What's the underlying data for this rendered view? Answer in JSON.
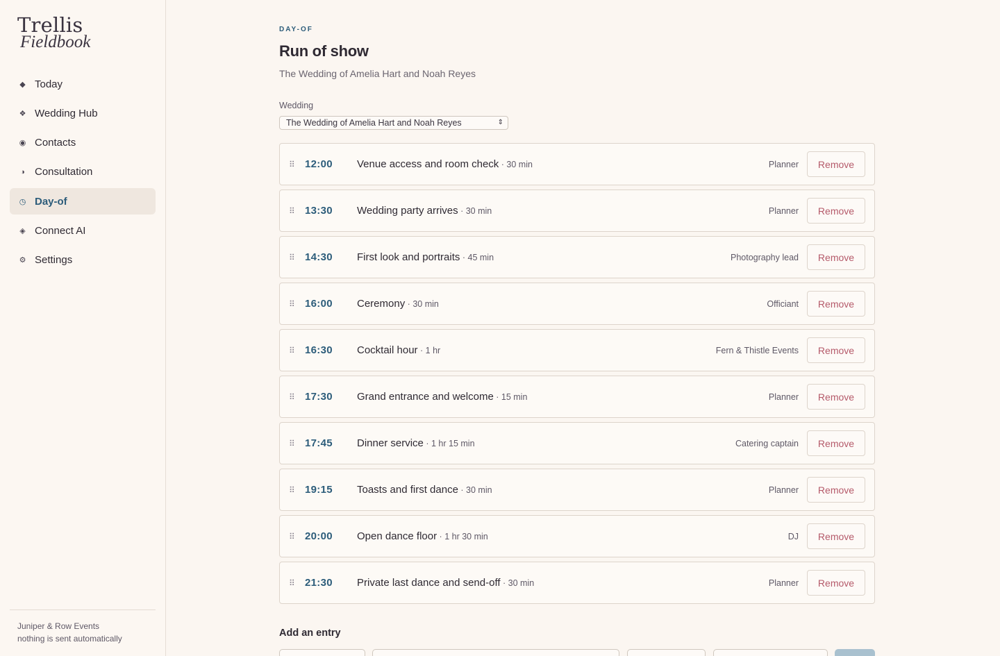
{
  "brand": {
    "line1": "Trellis",
    "line2": "Fieldbook"
  },
  "nav": [
    {
      "label": "Today",
      "icon": "diamond-icon",
      "glyph": "◆",
      "active": false
    },
    {
      "label": "Wedding Hub",
      "icon": "four-diamonds-icon",
      "glyph": "❖",
      "active": false
    },
    {
      "label": "Contacts",
      "icon": "circle-dot-icon",
      "glyph": "◉",
      "active": false
    },
    {
      "label": "Consultation",
      "icon": "half-circle-icon",
      "glyph": "◑",
      "active": false
    },
    {
      "label": "Day-of",
      "icon": "clock-icon",
      "glyph": "◷",
      "active": true
    },
    {
      "label": "Connect AI",
      "icon": "diamond-outline-icon",
      "glyph": "◈",
      "active": false
    },
    {
      "label": "Settings",
      "icon": "gear-icon",
      "glyph": "⚙",
      "active": false
    }
  ],
  "sidebar_footer": {
    "org": "Juniper & Row Events",
    "note": "nothing is sent automatically"
  },
  "header": {
    "eyebrow": "DAY-OF",
    "title": "Run of show",
    "subtitle": "The Wedding of Amelia Hart and Noah Reyes"
  },
  "wedding_select": {
    "label": "Wedding",
    "value": "The Wedding of Amelia Hart and Noah Reyes"
  },
  "entries": [
    {
      "time": "12:00",
      "task": "Venue access and room check",
      "duration": "30 min",
      "owner": "Planner",
      "action": "Remove"
    },
    {
      "time": "13:30",
      "task": "Wedding party arrives",
      "duration": "30 min",
      "owner": "Planner",
      "action": "Remove"
    },
    {
      "time": "14:30",
      "task": "First look and portraits",
      "duration": "45 min",
      "owner": "Photography lead",
      "action": "Remove"
    },
    {
      "time": "16:00",
      "task": "Ceremony",
      "duration": "30 min",
      "owner": "Officiant",
      "action": "Remove"
    },
    {
      "time": "16:30",
      "task": "Cocktail hour",
      "duration": "1 hr",
      "owner": "Fern & Thistle Events",
      "action": "Remove"
    },
    {
      "time": "17:30",
      "task": "Grand entrance and welcome",
      "duration": "15 min",
      "owner": "Planner",
      "action": "Remove"
    },
    {
      "time": "17:45",
      "task": "Dinner service",
      "duration": "1 hr 15 min",
      "owner": "Catering captain",
      "action": "Remove"
    },
    {
      "time": "19:15",
      "task": "Toasts and first dance",
      "duration": "30 min",
      "owner": "Planner",
      "action": "Remove"
    },
    {
      "time": "20:00",
      "task": "Open dance floor",
      "duration": "1 hr 30 min",
      "owner": "DJ",
      "action": "Remove"
    },
    {
      "time": "21:30",
      "task": "Private last dance and send-off",
      "duration": "30 min",
      "owner": "Planner",
      "action": "Remove"
    }
  ],
  "add_entry": {
    "title": "Add an entry"
  },
  "colors": {
    "accent": "#2c5c7a",
    "remove": "#b55a6a",
    "background": "#fbf6f1"
  }
}
